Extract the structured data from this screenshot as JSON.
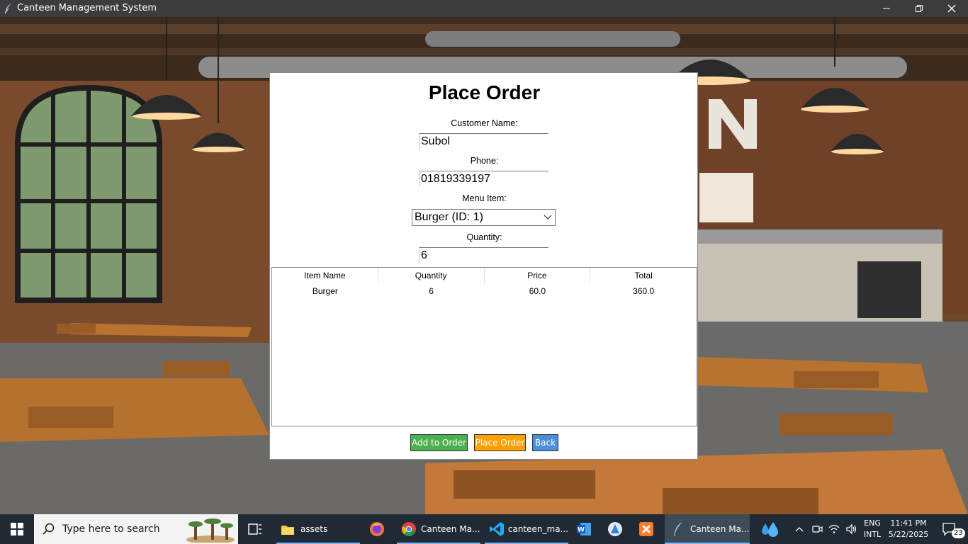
{
  "window": {
    "title": "Canteen Management System"
  },
  "form": {
    "heading": "Place Order",
    "customer_name_label": "Customer Name:",
    "customer_name_value": "Subol",
    "phone_label": "Phone:",
    "phone_value": "01819339197",
    "menu_item_label": "Menu Item:",
    "menu_item_selected": "Burger (ID: 1)",
    "quantity_label": "Quantity:",
    "quantity_value": "6"
  },
  "order_table": {
    "columns": [
      "Item Name",
      "Quantity",
      "Price",
      "Total"
    ],
    "rows": [
      [
        "Burger",
        "6",
        "60.0",
        "360.0"
      ]
    ]
  },
  "buttons": {
    "add_to_order": "Add to Order",
    "place_order": "Place Order",
    "back": "Back"
  },
  "colors": {
    "add_to_order_bg": "#4caf50",
    "place_order_bg": "#ff9f00",
    "back_bg": "#4a90d9"
  },
  "taskbar": {
    "search_placeholder": "Type here to search",
    "apps": [
      {
        "name": "task-view-icon",
        "label": ""
      },
      {
        "name": "file-explorer-icon",
        "label": "assets"
      },
      {
        "name": "firefox-icon",
        "label": ""
      },
      {
        "name": "chrome-icon",
        "label": "Canteen Ma..."
      },
      {
        "name": "vscode-icon",
        "label": "canteen_ma..."
      },
      {
        "name": "word-icon",
        "label": ""
      },
      {
        "name": "app-icon",
        "label": ""
      },
      {
        "name": "xampp-icon",
        "label": ""
      },
      {
        "name": "python-feather-icon",
        "label": "Canteen Ma..."
      }
    ],
    "language_top": "ENG",
    "language_bottom": "INTL",
    "time": "11:41 PM",
    "date": "5/22/2025",
    "notification_count": "23"
  }
}
